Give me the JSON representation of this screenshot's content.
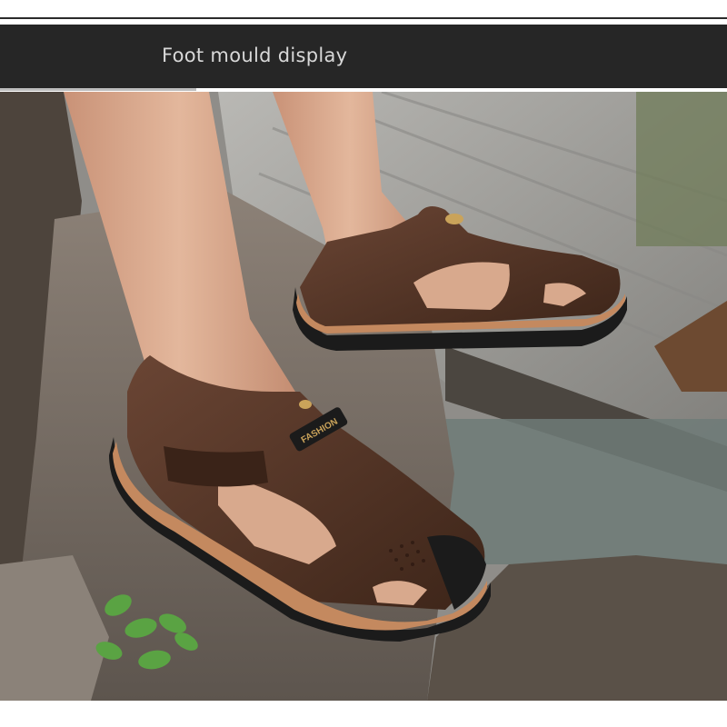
{
  "header": {
    "title": "Foot mould display"
  },
  "photo": {
    "sandal_badge_text": "FASHION",
    "colors": {
      "leather": "#4a2e22",
      "sole": "#c4895f",
      "outsole": "#1b1b1b",
      "skin": "#d8a98d",
      "rock": "#7d736a",
      "deck": "#9a9a98",
      "foliage": "#5aa343"
    }
  }
}
